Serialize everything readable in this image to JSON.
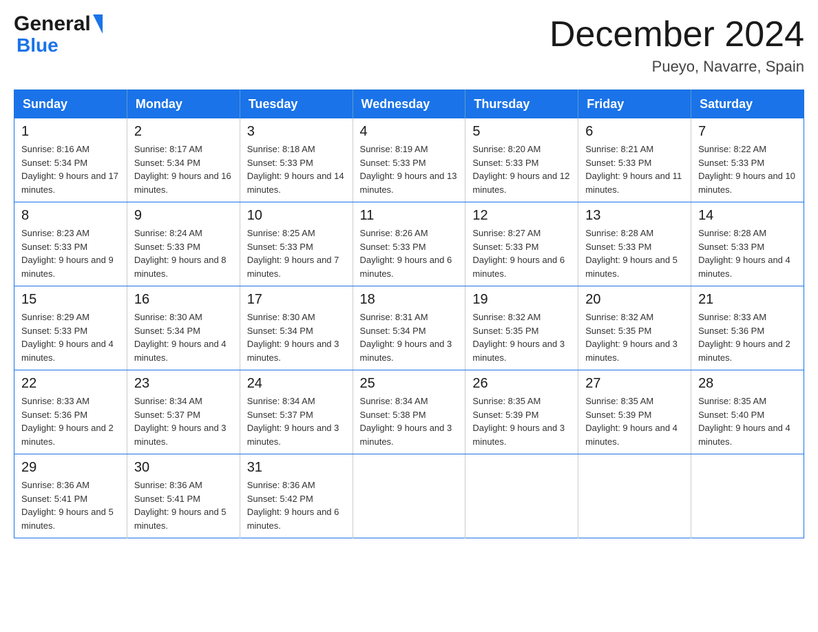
{
  "logo": {
    "general": "General",
    "blue": "Blue"
  },
  "title": {
    "month": "December 2024",
    "location": "Pueyo, Navarre, Spain"
  },
  "weekdays": [
    "Sunday",
    "Monday",
    "Tuesday",
    "Wednesday",
    "Thursday",
    "Friday",
    "Saturday"
  ],
  "weeks": [
    [
      {
        "day": "1",
        "sunrise": "8:16 AM",
        "sunset": "5:34 PM",
        "daylight": "9 hours and 17 minutes."
      },
      {
        "day": "2",
        "sunrise": "8:17 AM",
        "sunset": "5:34 PM",
        "daylight": "9 hours and 16 minutes."
      },
      {
        "day": "3",
        "sunrise": "8:18 AM",
        "sunset": "5:33 PM",
        "daylight": "9 hours and 14 minutes."
      },
      {
        "day": "4",
        "sunrise": "8:19 AM",
        "sunset": "5:33 PM",
        "daylight": "9 hours and 13 minutes."
      },
      {
        "day": "5",
        "sunrise": "8:20 AM",
        "sunset": "5:33 PM",
        "daylight": "9 hours and 12 minutes."
      },
      {
        "day": "6",
        "sunrise": "8:21 AM",
        "sunset": "5:33 PM",
        "daylight": "9 hours and 11 minutes."
      },
      {
        "day": "7",
        "sunrise": "8:22 AM",
        "sunset": "5:33 PM",
        "daylight": "9 hours and 10 minutes."
      }
    ],
    [
      {
        "day": "8",
        "sunrise": "8:23 AM",
        "sunset": "5:33 PM",
        "daylight": "9 hours and 9 minutes."
      },
      {
        "day": "9",
        "sunrise": "8:24 AM",
        "sunset": "5:33 PM",
        "daylight": "9 hours and 8 minutes."
      },
      {
        "day": "10",
        "sunrise": "8:25 AM",
        "sunset": "5:33 PM",
        "daylight": "9 hours and 7 minutes."
      },
      {
        "day": "11",
        "sunrise": "8:26 AM",
        "sunset": "5:33 PM",
        "daylight": "9 hours and 6 minutes."
      },
      {
        "day": "12",
        "sunrise": "8:27 AM",
        "sunset": "5:33 PM",
        "daylight": "9 hours and 6 minutes."
      },
      {
        "day": "13",
        "sunrise": "8:28 AM",
        "sunset": "5:33 PM",
        "daylight": "9 hours and 5 minutes."
      },
      {
        "day": "14",
        "sunrise": "8:28 AM",
        "sunset": "5:33 PM",
        "daylight": "9 hours and 4 minutes."
      }
    ],
    [
      {
        "day": "15",
        "sunrise": "8:29 AM",
        "sunset": "5:33 PM",
        "daylight": "9 hours and 4 minutes."
      },
      {
        "day": "16",
        "sunrise": "8:30 AM",
        "sunset": "5:34 PM",
        "daylight": "9 hours and 4 minutes."
      },
      {
        "day": "17",
        "sunrise": "8:30 AM",
        "sunset": "5:34 PM",
        "daylight": "9 hours and 3 minutes."
      },
      {
        "day": "18",
        "sunrise": "8:31 AM",
        "sunset": "5:34 PM",
        "daylight": "9 hours and 3 minutes."
      },
      {
        "day": "19",
        "sunrise": "8:32 AM",
        "sunset": "5:35 PM",
        "daylight": "9 hours and 3 minutes."
      },
      {
        "day": "20",
        "sunrise": "8:32 AM",
        "sunset": "5:35 PM",
        "daylight": "9 hours and 3 minutes."
      },
      {
        "day": "21",
        "sunrise": "8:33 AM",
        "sunset": "5:36 PM",
        "daylight": "9 hours and 2 minutes."
      }
    ],
    [
      {
        "day": "22",
        "sunrise": "8:33 AM",
        "sunset": "5:36 PM",
        "daylight": "9 hours and 2 minutes."
      },
      {
        "day": "23",
        "sunrise": "8:34 AM",
        "sunset": "5:37 PM",
        "daylight": "9 hours and 3 minutes."
      },
      {
        "day": "24",
        "sunrise": "8:34 AM",
        "sunset": "5:37 PM",
        "daylight": "9 hours and 3 minutes."
      },
      {
        "day": "25",
        "sunrise": "8:34 AM",
        "sunset": "5:38 PM",
        "daylight": "9 hours and 3 minutes."
      },
      {
        "day": "26",
        "sunrise": "8:35 AM",
        "sunset": "5:39 PM",
        "daylight": "9 hours and 3 minutes."
      },
      {
        "day": "27",
        "sunrise": "8:35 AM",
        "sunset": "5:39 PM",
        "daylight": "9 hours and 4 minutes."
      },
      {
        "day": "28",
        "sunrise": "8:35 AM",
        "sunset": "5:40 PM",
        "daylight": "9 hours and 4 minutes."
      }
    ],
    [
      {
        "day": "29",
        "sunrise": "8:36 AM",
        "sunset": "5:41 PM",
        "daylight": "9 hours and 5 minutes."
      },
      {
        "day": "30",
        "sunrise": "8:36 AM",
        "sunset": "5:41 PM",
        "daylight": "9 hours and 5 minutes."
      },
      {
        "day": "31",
        "sunrise": "8:36 AM",
        "sunset": "5:42 PM",
        "daylight": "9 hours and 6 minutes."
      },
      null,
      null,
      null,
      null
    ]
  ],
  "labels": {
    "sunrise": "Sunrise: ",
    "sunset": "Sunset: ",
    "daylight": "Daylight: "
  }
}
